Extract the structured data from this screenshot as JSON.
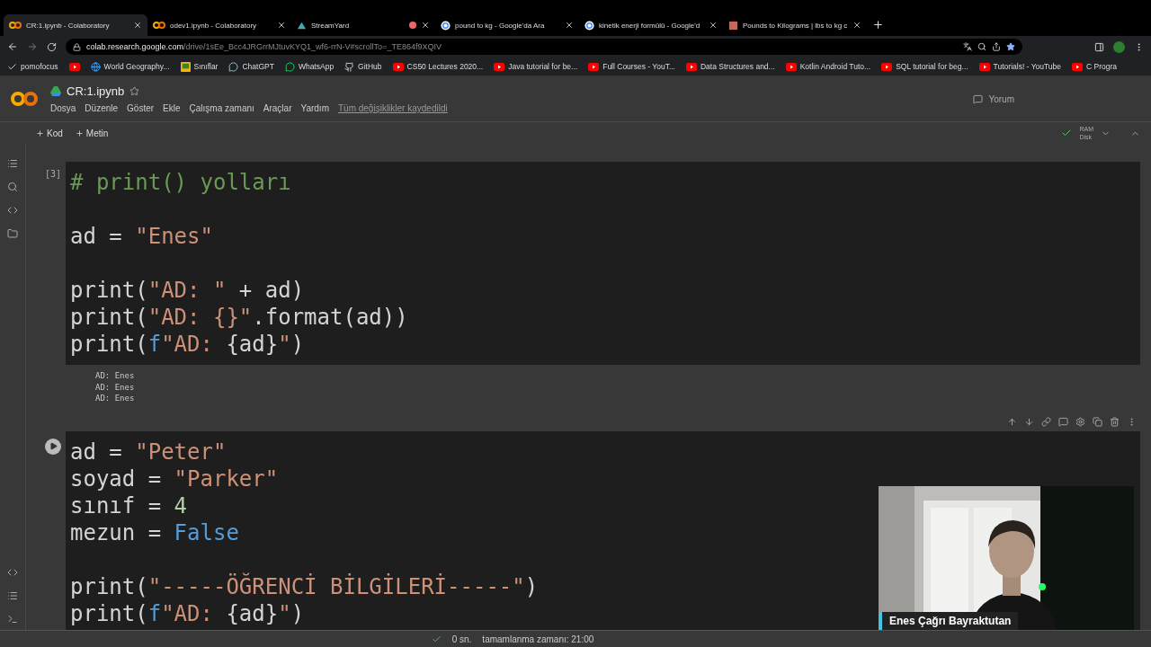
{
  "tabs": [
    {
      "title": "CR:1.ipynb - Colaboratory",
      "kind": "colab",
      "selected": true
    },
    {
      "title": "odev1.ipynb - Colaboratory",
      "kind": "colab",
      "selected": false
    },
    {
      "title": "StreamYard",
      "kind": "streamyard",
      "selected": false,
      "recording": true
    },
    {
      "title": "pound to kg - Google'da Ara",
      "kind": "google",
      "selected": false
    },
    {
      "title": "kinetik enerji formülü - Google'd",
      "kind": "google",
      "selected": false
    },
    {
      "title": "Pounds to Kilograms | lbs to kg c",
      "kind": "page",
      "selected": false
    }
  ],
  "address": {
    "host": "colab.research.google.com",
    "path": "/drive/1sEe_Bcc4JRGrrMJtuvKYQ1_wf6-rrN-V#scrollTo=_TE864f9XQIV"
  },
  "bookmarks": [
    {
      "label": "pomofocus",
      "kind": "check"
    },
    {
      "kind": "youtube"
    },
    {
      "label": "World Geography...",
      "kind": "globe"
    },
    {
      "label": "Sınıflar",
      "kind": "classroom"
    },
    {
      "label": "ChatGPT",
      "kind": "chat"
    },
    {
      "label": "WhatsApp",
      "kind": "whatsapp"
    },
    {
      "label": "GitHub",
      "kind": "github"
    },
    {
      "label": "CS50 Lectures 2020...",
      "kind": "youtube"
    },
    {
      "label": "Java tutorial for be...",
      "kind": "youtube"
    },
    {
      "label": "Full Courses - YouT...",
      "kind": "youtube"
    },
    {
      "label": "Data Structures and...",
      "kind": "youtube"
    },
    {
      "label": "Kotlin Android Tuto...",
      "kind": "youtube"
    },
    {
      "label": "SQL tutorial for beg...",
      "kind": "youtube"
    },
    {
      "label": "Tutorials! - YouTube",
      "kind": "youtube"
    },
    {
      "label": "C Progra",
      "kind": "youtube"
    }
  ],
  "notebook": {
    "title": "CR:1.ipynb",
    "menu": [
      "Dosya",
      "Düzenle",
      "Göster",
      "Ekle",
      "Çalışma zamanı",
      "Araçlar",
      "Yardım"
    ],
    "saved_note": "Tüm değişiklikler kaydedildi",
    "comment_button": "Yorum"
  },
  "toolbar": {
    "add": [
      "Kod",
      "Metin"
    ],
    "resources": [
      "RAM",
      "Disk"
    ]
  },
  "cells": [
    {
      "count": "[3]",
      "lines": [
        {
          "kind": "code",
          "tokens": [
            {
              "t": "# print() yolları",
              "kind": "comment"
            }
          ]
        },
        {
          "kind": "blank"
        },
        {
          "kind": "code",
          "tokens": [
            {
              "t": "ad = ",
              "kind": "plain"
            },
            {
              "t": "\"Enes\"",
              "kind": "str"
            }
          ]
        },
        {
          "kind": "blank"
        },
        {
          "kind": "code",
          "tokens": [
            {
              "t": "print(",
              "kind": "plain"
            },
            {
              "t": "\"AD: \"",
              "kind": "str"
            },
            {
              "t": " + ad)",
              "kind": "plain"
            }
          ]
        },
        {
          "kind": "code",
          "tokens": [
            {
              "t": "print(",
              "kind": "plain"
            },
            {
              "t": "\"AD: {}\"",
              "kind": "str"
            },
            {
              "t": ".format(ad))",
              "kind": "plain"
            }
          ]
        },
        {
          "kind": "code",
          "tokens": [
            {
              "t": "print(",
              "kind": "plain"
            },
            {
              "t": "f",
              "kind": "kw"
            },
            {
              "t": "\"AD: ",
              "kind": "str"
            },
            {
              "t": "{ad}",
              "kind": "plain"
            },
            {
              "t": "\"",
              "kind": "str"
            },
            {
              "t": ")",
              "kind": "plain"
            }
          ]
        }
      ],
      "output": [
        "AD: Enes",
        "AD: Enes",
        "AD: Enes"
      ]
    },
    {
      "lines": [
        {
          "kind": "code",
          "tokens": [
            {
              "t": "ad = ",
              "kind": "plain"
            },
            {
              "t": "\"Peter\"",
              "kind": "str"
            }
          ]
        },
        {
          "kind": "code",
          "tokens": [
            {
              "t": "soyad = ",
              "kind": "plain"
            },
            {
              "t": "\"Parker\"",
              "kind": "str"
            }
          ]
        },
        {
          "kind": "code",
          "tokens": [
            {
              "t": "sınıf = ",
              "kind": "plain"
            },
            {
              "t": "4",
              "kind": "num"
            }
          ]
        },
        {
          "kind": "code",
          "tokens": [
            {
              "t": "mezun = ",
              "kind": "plain"
            },
            {
              "t": "False",
              "kind": "kw"
            }
          ]
        },
        {
          "kind": "blank"
        },
        {
          "kind": "code",
          "tokens": [
            {
              "t": "print(",
              "kind": "plain"
            },
            {
              "t": "\"-----ÖĞRENCİ BİLGİLERİ-----\"",
              "kind": "str"
            },
            {
              "t": ")",
              "kind": "plain"
            }
          ]
        },
        {
          "kind": "code",
          "tokens": [
            {
              "t": "print(",
              "kind": "plain"
            },
            {
              "t": "f",
              "kind": "kw"
            },
            {
              "t": "\"AD: ",
              "kind": "str"
            },
            {
              "t": "{ad}",
              "kind": "plain"
            },
            {
              "t": "\"",
              "kind": "str"
            },
            {
              "t": ")",
              "kind": "plain"
            }
          ]
        }
      ]
    }
  ],
  "status": {
    "duration": "0 sn.",
    "completion": "tamamlanma zamanı: 21:00"
  },
  "webcam": {
    "kind": "picture",
    "name": "Enes Çağrı Bayraktutan"
  }
}
